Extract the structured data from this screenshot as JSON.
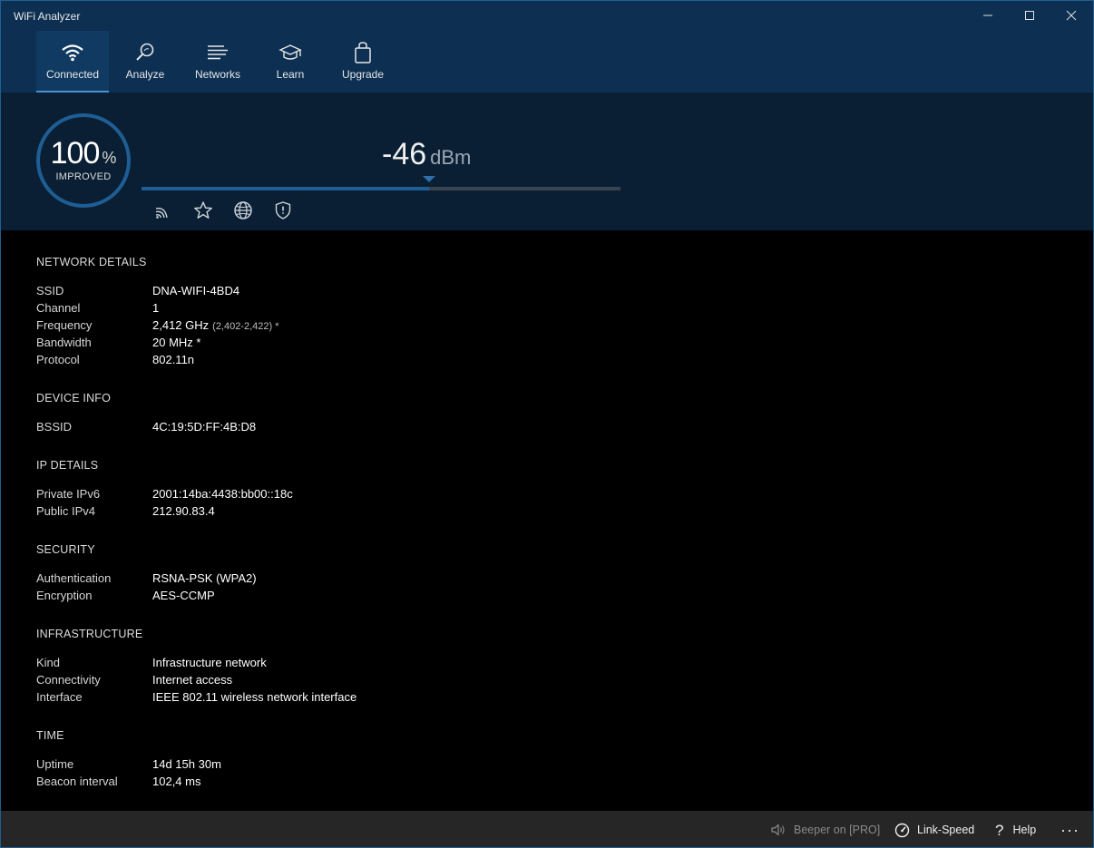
{
  "app": {
    "title": "WiFi Analyzer"
  },
  "nav": {
    "items": [
      {
        "label": "Connected",
        "icon": "wifi-icon",
        "active": true
      },
      {
        "label": "Analyze",
        "icon": "magnifier-icon",
        "active": false
      },
      {
        "label": "Networks",
        "icon": "list-icon",
        "active": false
      },
      {
        "label": "Learn",
        "icon": "graduation-cap-icon",
        "active": false
      },
      {
        "label": "Upgrade",
        "icon": "shopping-bag-icon",
        "active": false
      }
    ]
  },
  "signal": {
    "percent": "100",
    "percent_unit": "%",
    "percent_label": "IMPROVED",
    "dbm_value": "-46",
    "dbm_unit": "dBm",
    "strength_fraction": 0.6,
    "quick_icons": [
      "wifi-signal-icon",
      "star-icon",
      "globe-icon",
      "shield-icon"
    ]
  },
  "sections": [
    {
      "title": "NETWORK DETAILS",
      "rows": [
        {
          "key": "SSID",
          "value": "DNA-WIFI-4BD4"
        },
        {
          "key": "Channel",
          "value": "1"
        },
        {
          "key": "Frequency",
          "value": "2,412 GHz",
          "sub": "(2,402-2,422) *"
        },
        {
          "key": "Bandwidth",
          "value": "20 MHz *"
        },
        {
          "key": "Protocol",
          "value": "802.11n"
        }
      ]
    },
    {
      "title": "DEVICE INFO",
      "rows": [
        {
          "key": "BSSID",
          "value": "4C:19:5D:FF:4B:D8"
        }
      ]
    },
    {
      "title": "IP DETAILS",
      "rows": [
        {
          "key": "Private IPv6",
          "value": "2001:14ba:4438:bb00::18c"
        },
        {
          "key": "Public IPv4",
          "value": "212.90.83.4"
        }
      ]
    },
    {
      "title": "SECURITY",
      "rows": [
        {
          "key": "Authentication",
          "value": "RSNA-PSK (WPA2)"
        },
        {
          "key": "Encryption",
          "value": "AES-CCMP"
        }
      ]
    },
    {
      "title": "INFRASTRUCTURE",
      "rows": [
        {
          "key": "Kind",
          "value": "Infrastructure network"
        },
        {
          "key": "Connectivity",
          "value": "Internet access"
        },
        {
          "key": "Interface",
          "value": "IEEE 802.11 wireless network interface"
        }
      ]
    },
    {
      "title": "TIME",
      "rows": [
        {
          "key": "Uptime",
          "value": "14d 15h 30m"
        },
        {
          "key": "Beacon interval",
          "value": "102,4 ms"
        }
      ]
    }
  ],
  "statusbar": {
    "beeper_label": "Beeper on [PRO]",
    "link_speed_label": "Link-Speed",
    "help_label": "Help",
    "more_label": "···"
  },
  "colors": {
    "header_bg": "#0c2f52",
    "panel_bg": "#0a1f33",
    "accent": "#1e5e94",
    "content_bg": "#000000",
    "statusbar_bg": "#262626"
  }
}
